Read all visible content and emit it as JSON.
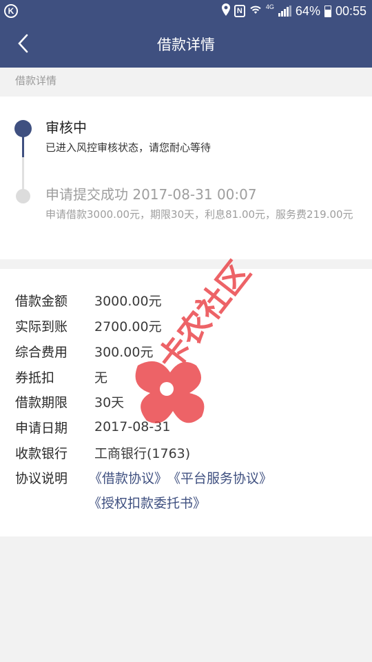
{
  "status_bar": {
    "left_icon": "K",
    "network": "4G",
    "battery_level": 0.64,
    "battery_text": "64%",
    "time": "00:55"
  },
  "header": {
    "back_icon": "chevron-left-icon",
    "title": "借款详情"
  },
  "section_label": "借款详情",
  "status": {
    "step1_title": "审核中",
    "step1_desc": "已进入风控审核状态，请您耐心等待",
    "step2_title": "申请提交成功 2017-08-31 00:07",
    "step2_desc": "申请借款3000.00元，期限30天，利息81.00元，服务费219.00元"
  },
  "details": {
    "rows": [
      {
        "label": "借款金额",
        "value": "3000.00元"
      },
      {
        "label": "实际到账",
        "value": "2700.00元"
      },
      {
        "label": "综合费用",
        "value": "300.00元"
      },
      {
        "label": "券抵扣",
        "value": "无"
      },
      {
        "label": "借款期限",
        "value": "30天"
      },
      {
        "label": "申请日期",
        "value": "2017-08-31"
      },
      {
        "label": "收款银行",
        "value": "工商银行(1763)"
      }
    ],
    "agreement_label": "协议说明",
    "agreements": [
      "《借款协议》",
      "《平台服务协议》",
      "《授权扣款委托书》"
    ]
  },
  "watermark": {
    "text": "卡农社区"
  },
  "colors": {
    "primary": "#3f5080",
    "watermark": "#e8383d"
  }
}
